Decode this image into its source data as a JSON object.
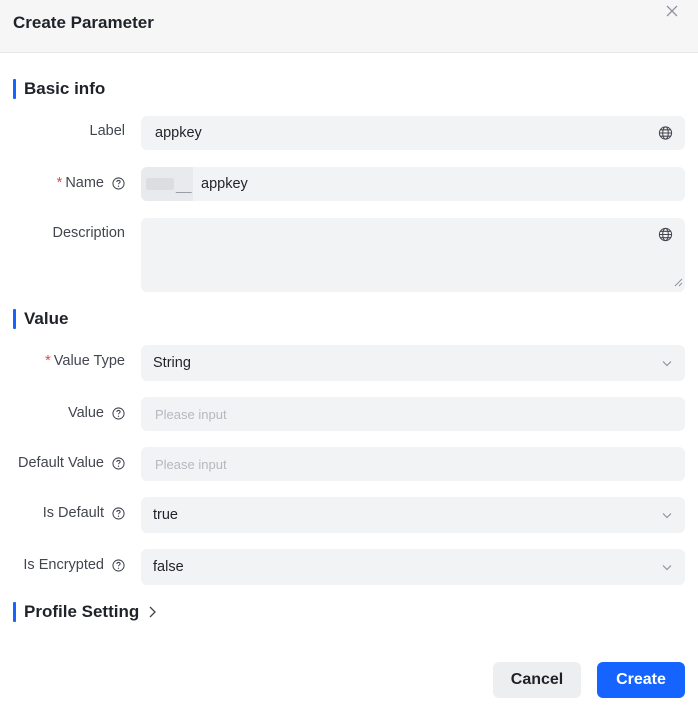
{
  "dialog": {
    "title": "Create Parameter"
  },
  "basic_info": {
    "title": "Basic info",
    "label": {
      "label": "Label",
      "value": "appkey"
    },
    "name": {
      "required": "*",
      "label": "Name",
      "value": "appkey",
      "prefix": "__"
    },
    "description": {
      "label": "Description",
      "value": ""
    }
  },
  "value_section": {
    "title": "Value",
    "value_type": {
      "required": "*",
      "label": "Value Type",
      "selected": "String"
    },
    "value": {
      "label": "Value",
      "placeholder": "Please input"
    },
    "default_value": {
      "label": "Default Value",
      "placeholder": "Please input"
    },
    "is_default": {
      "label": "Is Default",
      "selected": "true"
    },
    "is_encrypted": {
      "label": "Is Encrypted",
      "selected": "false"
    }
  },
  "profile_setting": {
    "title": "Profile Setting"
  },
  "footer": {
    "cancel_label": "Cancel",
    "create_label": "Create"
  },
  "colors": {
    "accent": "#1664ff",
    "required": "#e8473f",
    "field_bg": "#f2f3f5"
  }
}
